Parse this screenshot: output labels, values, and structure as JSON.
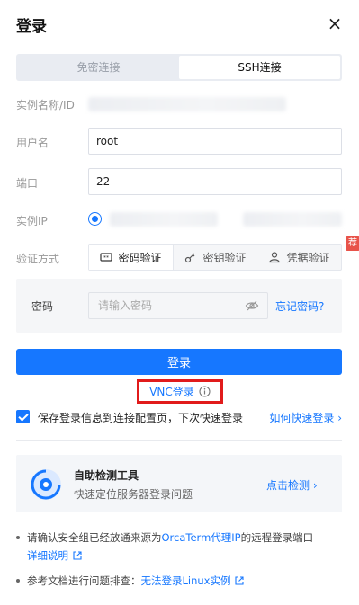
{
  "header": {
    "title": "登录",
    "close_glyph": "×"
  },
  "mode_tabs": [
    {
      "label": "免密连接",
      "active": false
    },
    {
      "label": "SSH连接",
      "active": true
    }
  ],
  "form": {
    "instance_name_label": "实例名称/ID",
    "username_label": "用户名",
    "username_value": "root",
    "port_label": "端口",
    "port_value": "22",
    "instance_ip_label": "实例IP",
    "auth_label": "验证方式",
    "auth_tabs": [
      {
        "label": "密码验证",
        "icon": "password-icon",
        "active": true
      },
      {
        "label": "密钥验证",
        "icon": "key-icon",
        "active": false
      },
      {
        "label": "凭据验证",
        "icon": "credential-icon",
        "active": false
      }
    ],
    "recommend_badge": "荐",
    "password_label": "密码",
    "password_placeholder": "请输入密码",
    "forgot_password": "忘记密码?"
  },
  "actions": {
    "login_label": "登录",
    "vnc_login_label": "VNC登录",
    "save_config_label": "保存登录信息到连接配置页，下次快速登录",
    "save_config_checked": true,
    "quick_login_link": "如何快速登录"
  },
  "tool": {
    "title": "自助检测工具",
    "subtitle": "快速定位服务器登录问题",
    "action": "点击检测"
  },
  "tips": {
    "tip1_prefix": "请确认安全组已经放通来源为",
    "tip1_link": "OrcaTerm代理IP",
    "tip1_suffix": "的远程登录端口",
    "tip1_detail": "详细说明",
    "tip2_prefix": "参考文档进行问题排查：",
    "tip2_link": "无法登录Linux实例"
  },
  "colors": {
    "primary": "#1677ff",
    "highlight_box": "#e11b1b",
    "badge": "#e8534a"
  }
}
